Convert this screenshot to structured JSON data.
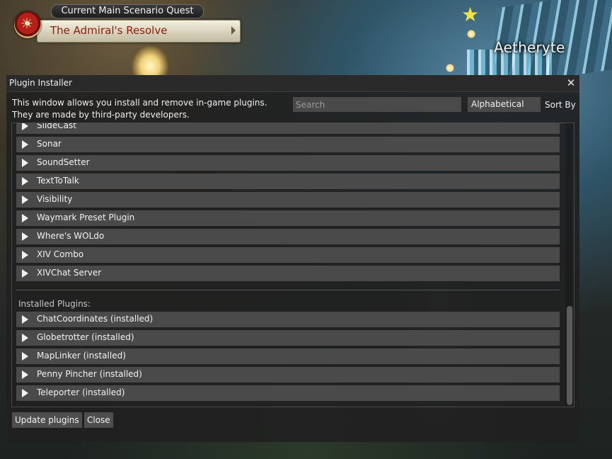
{
  "hud": {
    "quest_header": "Current Main Scenario Quest",
    "quest_title": "The Admiral's Resolve",
    "aetheryte_label": "Aetheryte"
  },
  "window": {
    "title": "Plugin Installer",
    "description_line1": "This window allows you install and remove in-game plugins.",
    "description_line2": "They are made by third-party developers.",
    "search_placeholder": "Search",
    "search_value": "",
    "sort_selected": "Alphabetical",
    "sort_label": "Sort By",
    "available_plugins": [
      {
        "label": "SlideCast"
      },
      {
        "label": "Sonar"
      },
      {
        "label": "SoundSetter"
      },
      {
        "label": "TextToTalk"
      },
      {
        "label": "Visibility"
      },
      {
        "label": "Waymark Preset Plugin"
      },
      {
        "label": "Where's WOLdo"
      },
      {
        "label": "XIV Combo"
      },
      {
        "label": "XIVChat Server"
      }
    ],
    "installed_heading": "Installed Plugins:",
    "installed_plugins": [
      {
        "label": "ChatCoordinates (installed)"
      },
      {
        "label": "Globetrotter (installed)"
      },
      {
        "label": "MapLinker (installed)"
      },
      {
        "label": "Penny Pincher (installed)"
      },
      {
        "label": "Teleporter (installed)"
      }
    ],
    "buttons": {
      "update": "Update plugins",
      "close": "Close"
    }
  },
  "colors": {
    "window_bg": "#202020",
    "row_bg": "#4a4a4a",
    "quest_title": "#8e1b0e",
    "aetheryte_text": "#f2f6f8"
  }
}
